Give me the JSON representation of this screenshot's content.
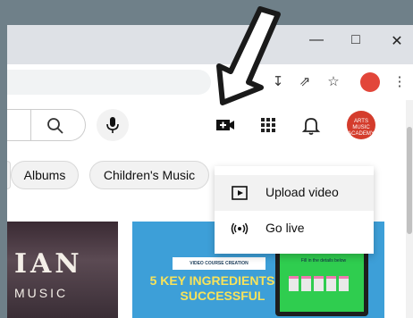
{
  "chips": [
    {
      "label": "Albums"
    },
    {
      "label": "Children's Music"
    }
  ],
  "menu": {
    "upload_label": "Upload video",
    "live_label": "Go live"
  },
  "thumbnails": [
    {
      "title_line1": "IAN",
      "title_line2": "MUSIC"
    },
    {
      "badge": "VIDEO COURSE CREATION",
      "headline": "5 KEY INGREDIENTS TO SUCCESSFUL",
      "screen_caption": "Fill in the details below"
    }
  ],
  "channel_avatar_text": "ARTS MUSIC ACADEMY",
  "colors": {
    "avatar": "#d43c2c",
    "thumb_bg": "#3d9fd8",
    "headline": "#f8e35a"
  }
}
